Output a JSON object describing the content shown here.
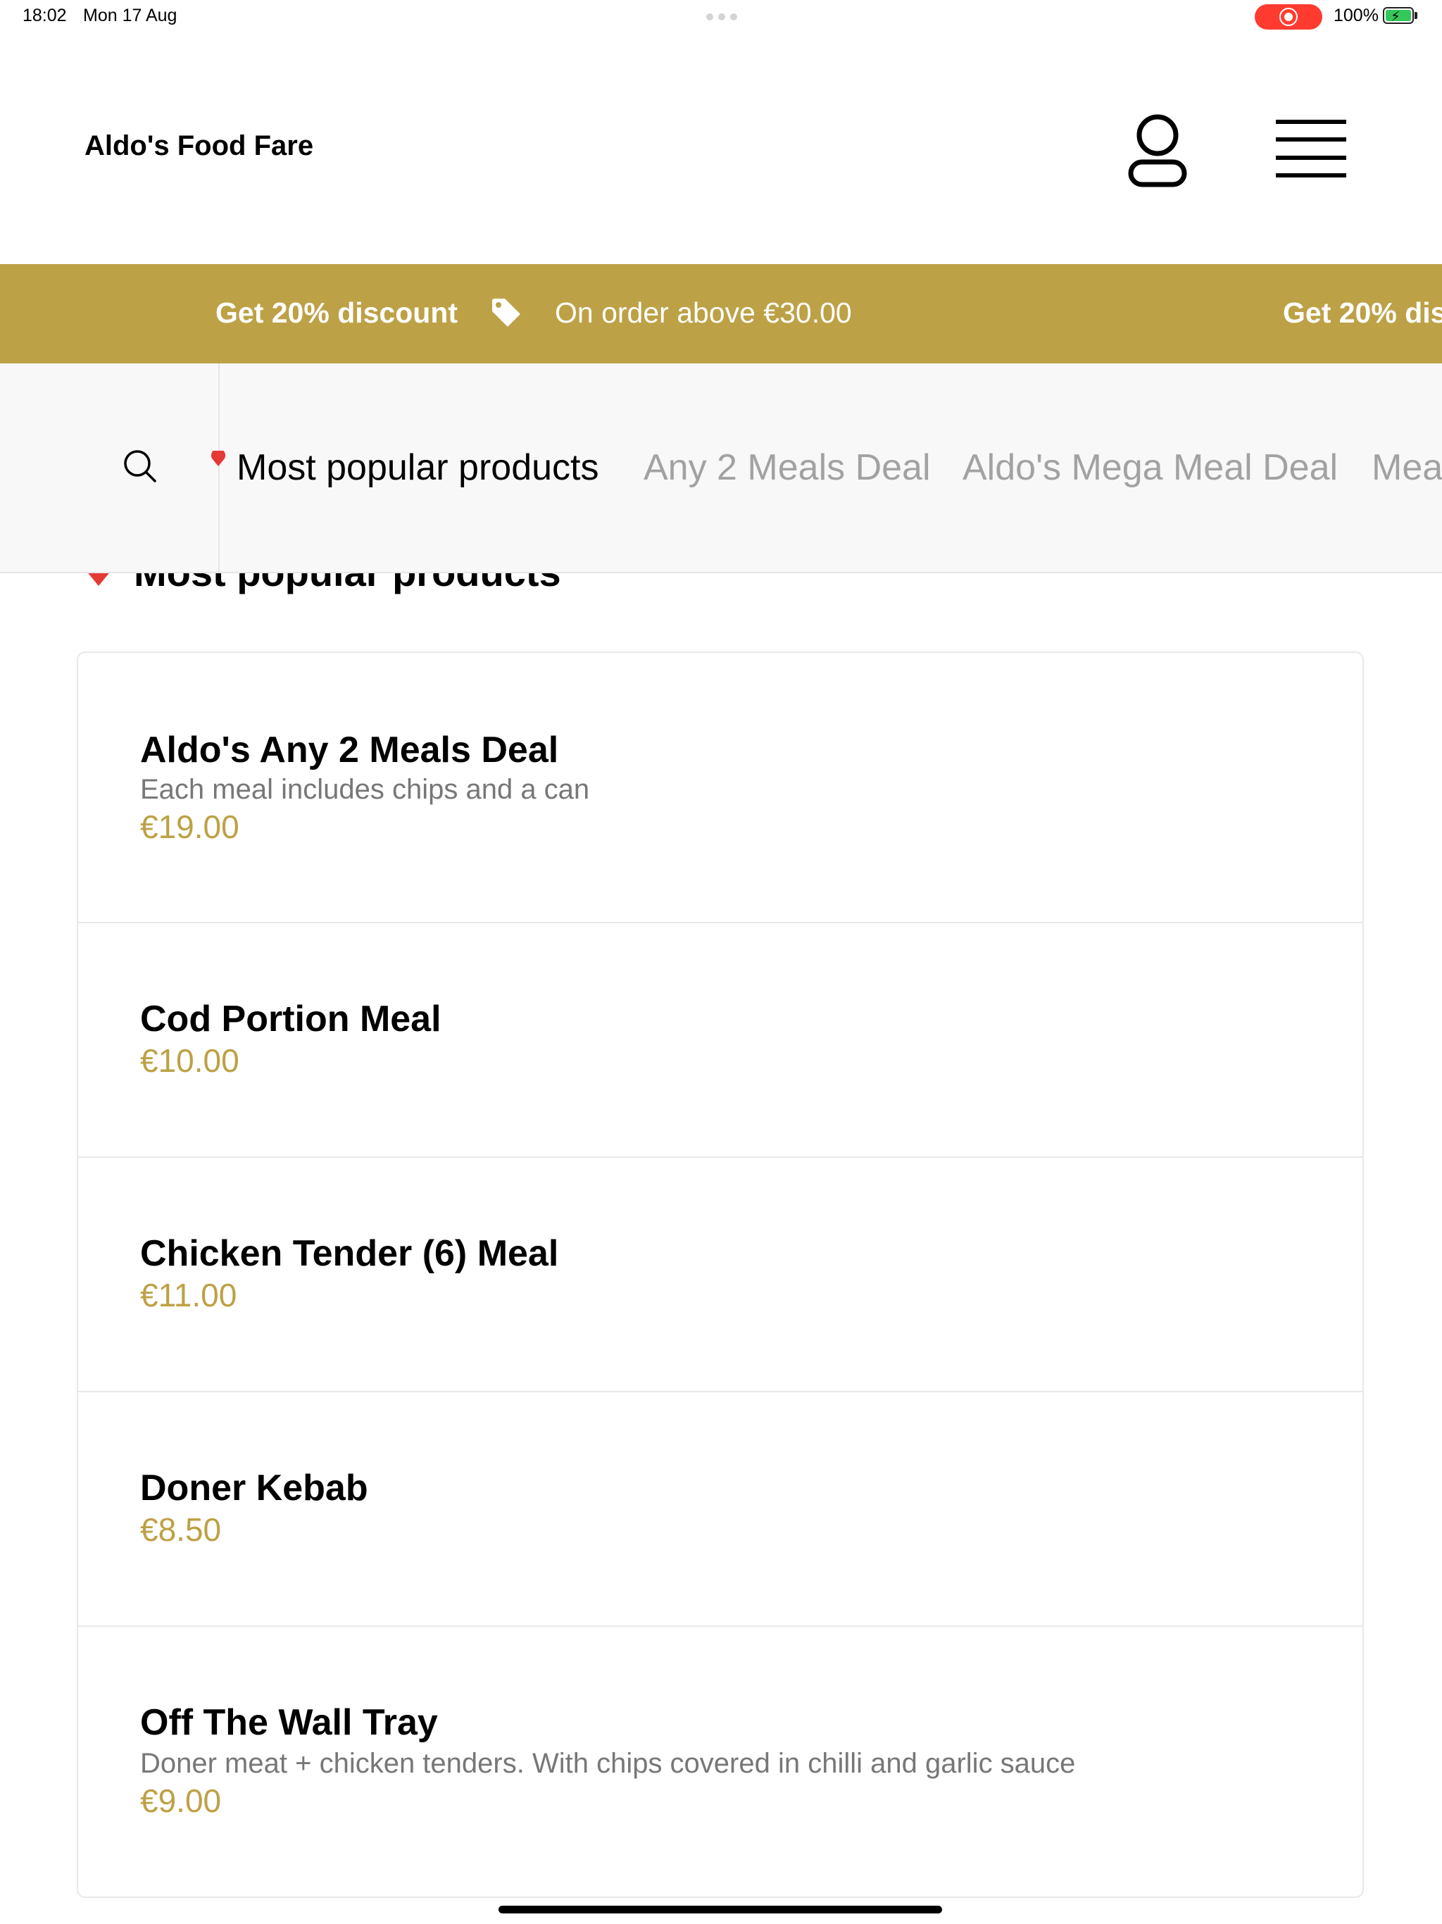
{
  "status_bar": {
    "time": "18:02",
    "date": "Mon 17 Aug",
    "battery": "100%"
  },
  "header": {
    "brand": "Aldo's Food Fare",
    "icons": [
      "account-icon",
      "menu-icon"
    ]
  },
  "promo": {
    "headline": "Get 20% discount",
    "detail": "On order above €30.00",
    "headline_repeat": "Get 20% dis",
    "color": "#bda146"
  },
  "category_nav": {
    "items": [
      "Most popular products",
      "Any 2 Meals Deal",
      "Aldo's Mega Meal Deal",
      "Mea"
    ],
    "active_index": 0
  },
  "section": {
    "title": "Most popular products"
  },
  "products": [
    {
      "name": "Aldo's Any 2 Meals Deal",
      "description": "Each meal includes chips and a can",
      "price": "€19.00"
    },
    {
      "name": "Cod Portion Meal",
      "description": "",
      "price": "€10.00"
    },
    {
      "name": "Chicken Tender (6) Meal",
      "description": "",
      "price": "€11.00"
    },
    {
      "name": "Doner Kebab",
      "description": "",
      "price": "€8.50"
    },
    {
      "name": "Off The Wall Tray",
      "description": "Doner meat + chicken tenders. With chips covered in chilli and garlic sauce",
      "price": "€9.00"
    }
  ]
}
